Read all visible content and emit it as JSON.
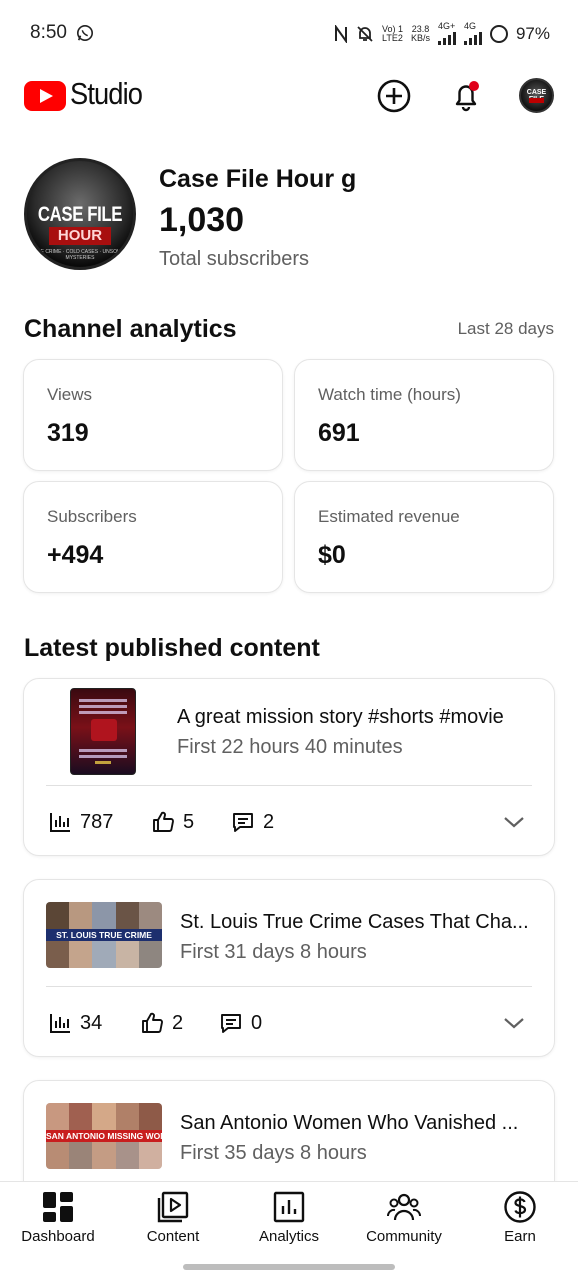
{
  "status_bar": {
    "time": "8:50",
    "volte": "Vo) 1",
    "lte": "LTE2",
    "speed_value": "23.8",
    "speed_unit": "KB/s",
    "net1": "4G+",
    "net2": "4G",
    "battery": "97%"
  },
  "header": {
    "brand": "Studio"
  },
  "channel": {
    "avatar_title": "CASE FILE",
    "avatar_hour": "HOUR",
    "avatar_sub": "TRUE CRIME · COLD CASES · UNSOLVED MYSTERIES",
    "name": "Case File Hour g",
    "subscriber_count": "1,030",
    "subscriber_label": "Total subscribers"
  },
  "analytics": {
    "title": "Channel analytics",
    "period": "Last 28 days",
    "metrics": [
      {
        "label": "Views",
        "value": "319"
      },
      {
        "label": "Watch time (hours)",
        "value": "691"
      },
      {
        "label": "Subscribers",
        "value": "+494"
      },
      {
        "label": "Estimated revenue",
        "value": "$0"
      }
    ]
  },
  "content": {
    "title": "Latest published content",
    "items": [
      {
        "title": "A great mission story #shorts #movie",
        "subtitle": "First 22 hours 40 minutes",
        "views": "787",
        "likes": "5",
        "comments": "2"
      },
      {
        "title": "St. Louis True Crime Cases That Cha...",
        "subtitle": "First 31 days 8 hours",
        "views": "34",
        "likes": "2",
        "comments": "0",
        "thumb_banner": "ST. LOUIS TRUE CRIME"
      },
      {
        "title": "San Antonio Women Who Vanished ...",
        "subtitle": "First 35 days 8 hours",
        "thumb_banner": "SAN ANTONIO MISSING WOMEN"
      }
    ]
  },
  "bottom_nav": {
    "items": [
      {
        "label": "Dashboard",
        "icon": "dashboard-icon"
      },
      {
        "label": "Content",
        "icon": "content-icon"
      },
      {
        "label": "Analytics",
        "icon": "analytics-icon"
      },
      {
        "label": "Community",
        "icon": "community-icon"
      },
      {
        "label": "Earn",
        "icon": "earn-icon"
      }
    ]
  },
  "colors": {
    "brand_red": "#ff0000",
    "notification_dot": "#e0001b",
    "secondary_text": "#606060"
  }
}
